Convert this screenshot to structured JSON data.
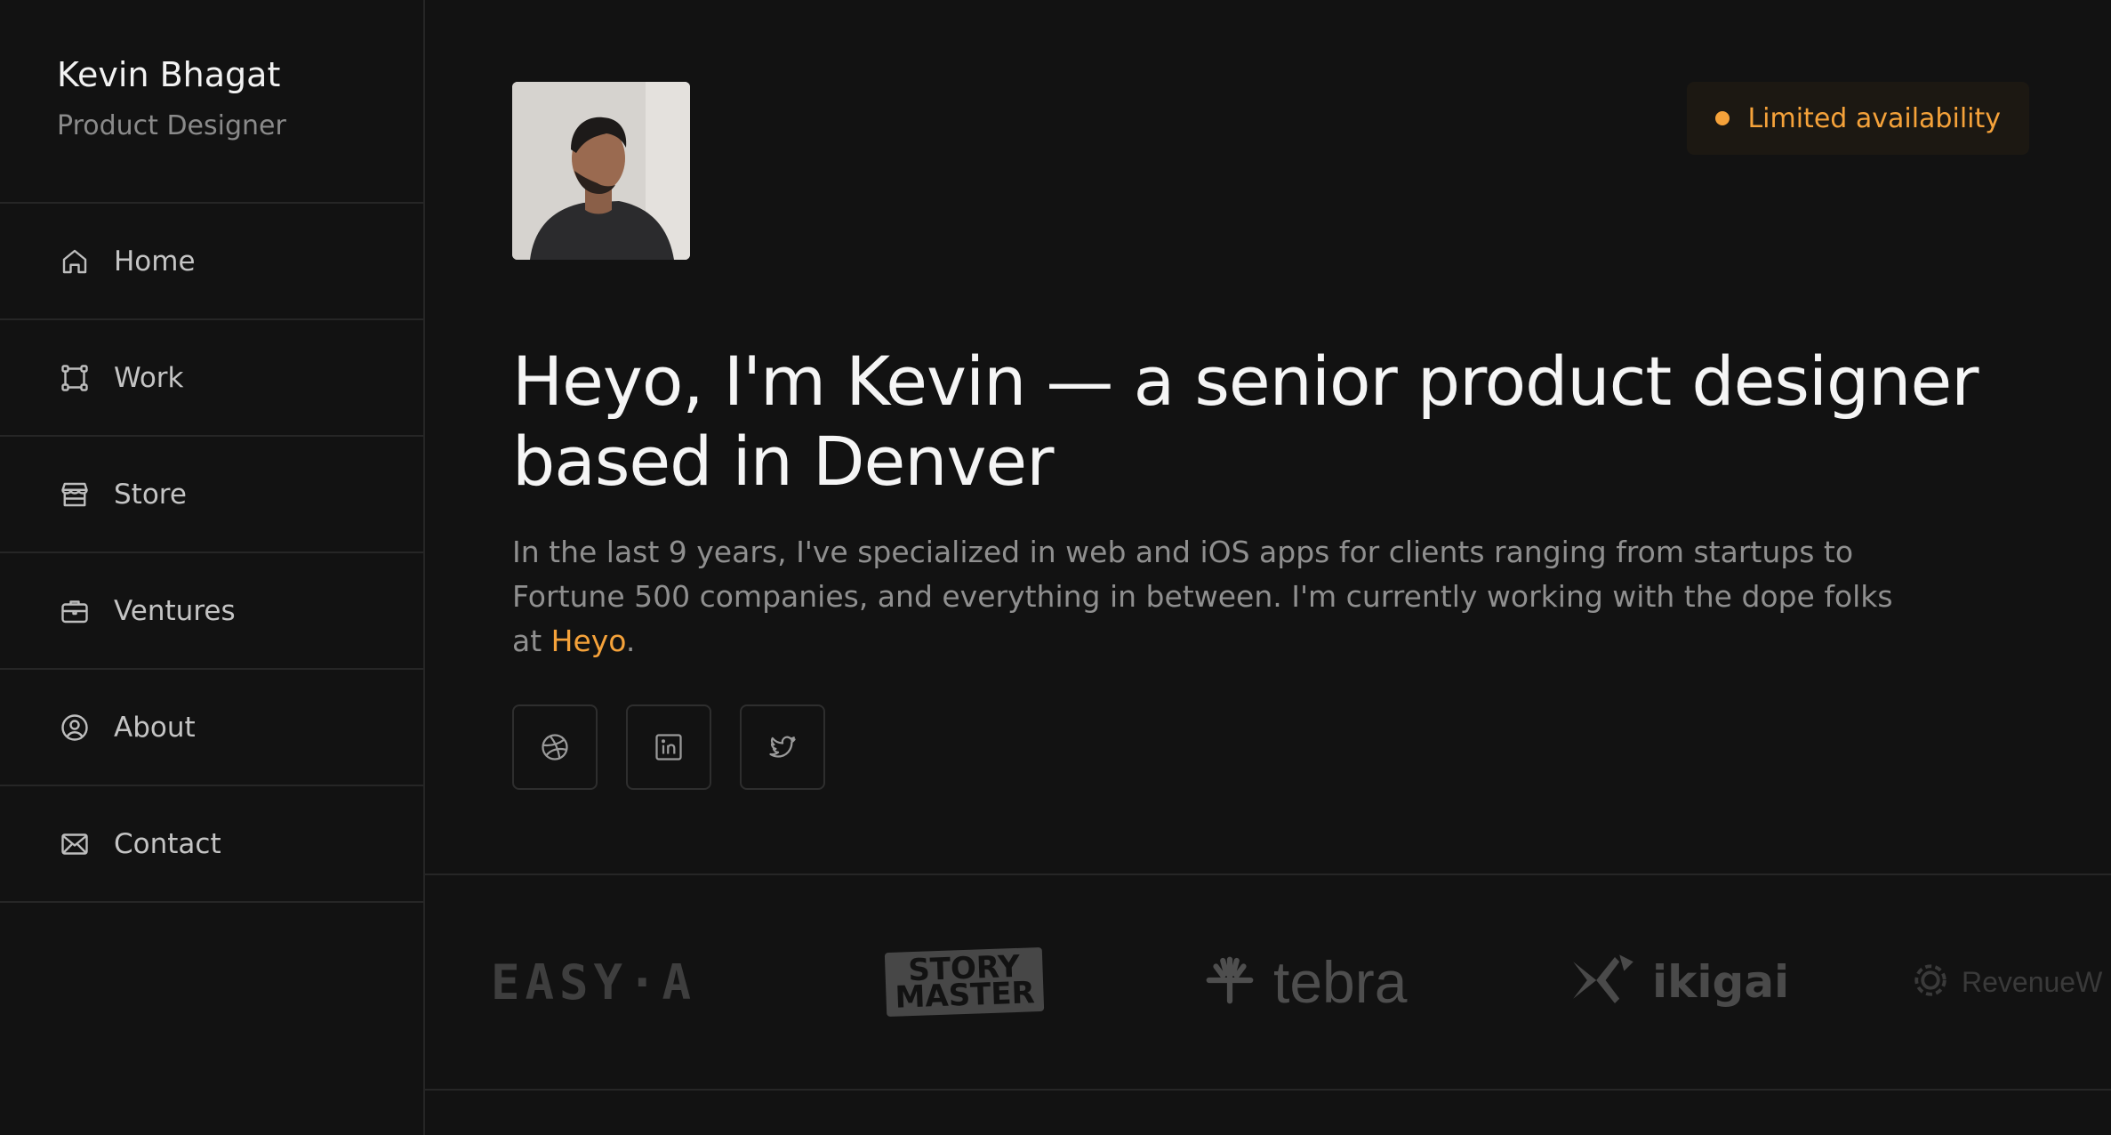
{
  "sidebar": {
    "name": "Kevin Bhagat",
    "role": "Product Designer",
    "items": [
      {
        "label": "Home",
        "icon": "home-icon"
      },
      {
        "label": "Work",
        "icon": "work-icon"
      },
      {
        "label": "Store",
        "icon": "store-icon"
      },
      {
        "label": "Ventures",
        "icon": "briefcase-icon"
      },
      {
        "label": "About",
        "icon": "user-circle-icon"
      },
      {
        "label": "Contact",
        "icon": "mail-icon"
      }
    ]
  },
  "main": {
    "availability": "Limited availability",
    "headline": "Heyo, I'm Kevin — a senior product designer based in Denver",
    "intro_before": "In the last 9 years, I've specialized in web and iOS apps for clients ranging from startups to Fortune 500 companies, and everything in between. I'm currently working with the dope folks at ",
    "intro_link": "Heyo",
    "intro_after": ".",
    "socials": [
      {
        "icon": "dribbble-icon"
      },
      {
        "icon": "linkedin-icon"
      },
      {
        "icon": "twitter-icon"
      }
    ],
    "logos": {
      "easya": "EASY·A",
      "story_line1": "STORY",
      "story_line2": "MASTER",
      "tebra": "tebra",
      "ikigai": "ikigai",
      "revenue": "RevenueW"
    }
  },
  "colors": {
    "background": "#121212",
    "accent": "#f5a23a",
    "border": "#262626"
  }
}
